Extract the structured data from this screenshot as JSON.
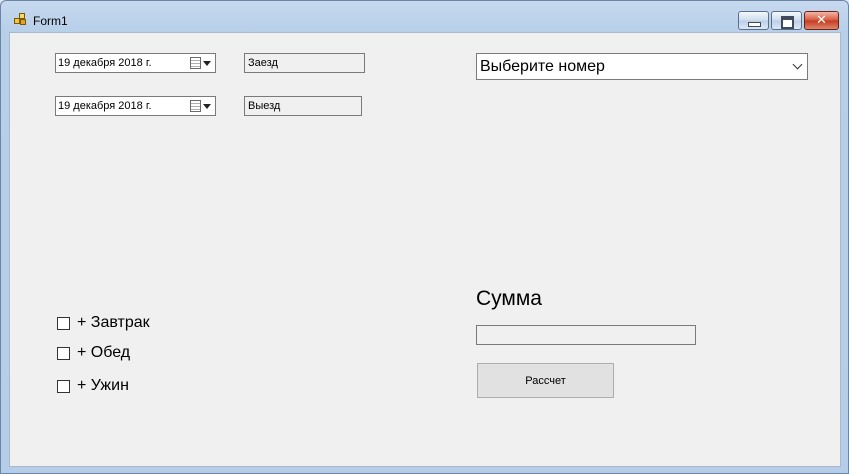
{
  "window": {
    "title": "Form1"
  },
  "dates": {
    "checkin_value": "19  декабря  2018 г.",
    "checkout_value": "19  декабря  2018 г."
  },
  "labels": {
    "checkin": "Заезд",
    "checkout": "Выезд"
  },
  "room_select": {
    "selected": "Выберите номер"
  },
  "meals": [
    {
      "label": "+ Завтрак",
      "checked": false
    },
    {
      "label": "+ Обед",
      "checked": false
    },
    {
      "label": "+ Ужин",
      "checked": false
    }
  ],
  "total": {
    "label": "Сумма",
    "value": ""
  },
  "calc_button": {
    "label": "Рассчет"
  },
  "icons": {
    "app": "form-app-icon",
    "minimize": "minimize-icon",
    "maximize": "maximize-icon",
    "close": "close-icon",
    "calendar": "calendar-icon",
    "dropdown": "chevron-down-icon"
  }
}
